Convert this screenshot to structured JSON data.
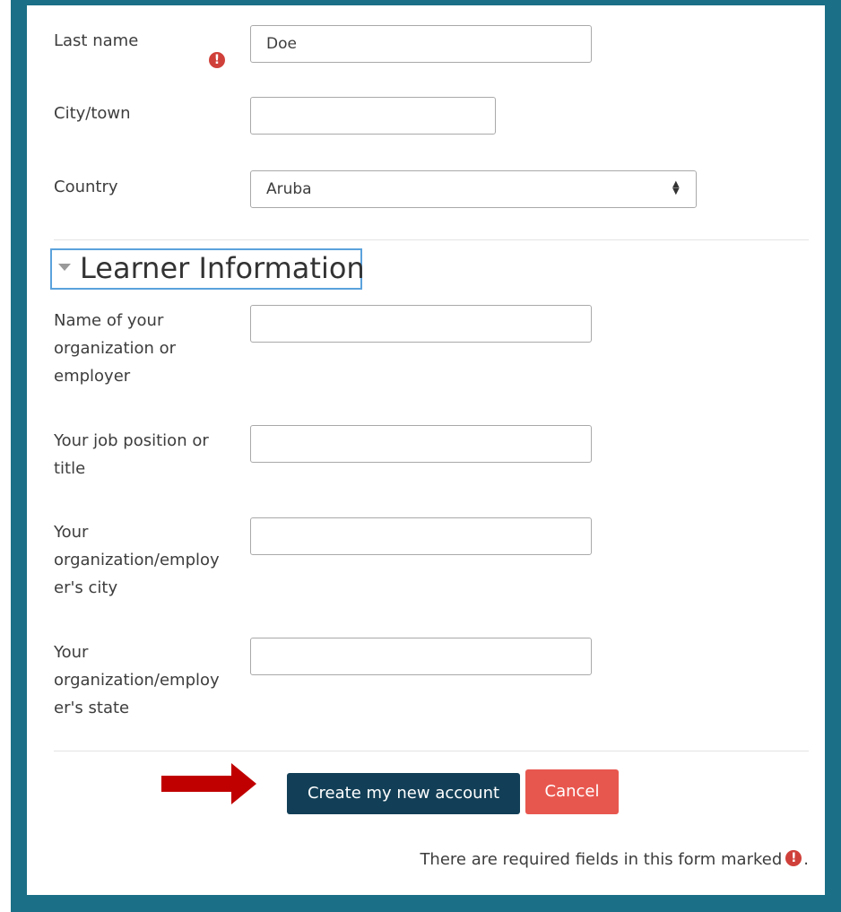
{
  "form": {
    "last_name": {
      "label": "Last name",
      "value": "Doe"
    },
    "city": {
      "label": "City/town",
      "value": ""
    },
    "country": {
      "label": "Country",
      "value": "Aruba"
    }
  },
  "section": {
    "title": "Learner Information"
  },
  "learner": {
    "organization": {
      "label_lines": [
        "Name of your",
        "organization or",
        "employer"
      ],
      "value": ""
    },
    "job": {
      "label_lines": [
        "Your job position or",
        "title"
      ],
      "value": ""
    },
    "org_city": {
      "label_lines": [
        "Your",
        "organization/employ",
        "er's city"
      ],
      "value": ""
    },
    "org_state": {
      "label_lines": [
        "Your",
        "organization/employ",
        "er's state"
      ],
      "value": ""
    }
  },
  "buttons": {
    "create": "Create my new account",
    "cancel": "Cancel"
  },
  "footer": {
    "required_note": "There are required fields in this form marked",
    "period": "."
  },
  "icons": {
    "required": "exclamation-circle-icon",
    "select": "sort-arrows-icon",
    "section_toggle": "collapse-triangle-icon",
    "pointer_arrow": "red-arrow-icon"
  },
  "colors": {
    "frame": "#1b6f86",
    "primary_button": "#123f57",
    "cancel_button": "#e8574e",
    "required_icon": "#d0403a",
    "focus_border": "#5ba2dc",
    "arrow": "#c00000"
  }
}
